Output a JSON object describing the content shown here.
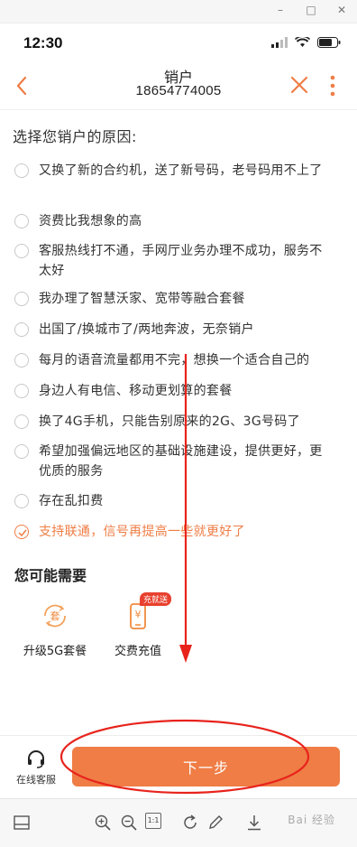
{
  "window": {
    "controls": [
      "–",
      "□",
      "✕"
    ]
  },
  "status_bar": {
    "time": "12:30"
  },
  "nav": {
    "title": "销户",
    "subtitle": "18654774005"
  },
  "content": {
    "section_title": "选择您销户的原因:",
    "reasons": [
      {
        "label": "又换了新的合约机，送了新号码，老号码用不上了",
        "checked": false
      },
      {
        "label": "资费比我想象的高",
        "checked": false
      },
      {
        "label": "客服热线打不通，手网厅业务办理不成功，服务不太好",
        "checked": false
      },
      {
        "label": "我办理了智慧沃家、宽带等融合套餐",
        "checked": false
      },
      {
        "label": "出国了/换城市了/两地奔波，无奈销户",
        "checked": false
      },
      {
        "label": "每月的语音流量都用不完，想换一个适合自己的",
        "checked": false
      },
      {
        "label": "身边人有电信、移动更划算的套餐",
        "checked": false
      },
      {
        "label": "换了4G手机，只能告别原来的2G、3G号码了",
        "checked": false
      },
      {
        "label": "希望加强偏远地区的基础设施建设，提供更好，更优质的服务",
        "checked": false
      },
      {
        "label": "存在乱扣费",
        "checked": false
      },
      {
        "label": "支持联通，信号再提高一些就更好了",
        "checked": true
      }
    ],
    "need_title": "您可能需要",
    "needs": [
      {
        "label": "升级5G套餐",
        "icon": "package-upgrade-icon",
        "icon_text": "套"
      },
      {
        "label": "交费充值",
        "icon": "recharge-phone-icon",
        "icon_text": "¥",
        "badge": "充就送"
      }
    ]
  },
  "bottom_bar": {
    "service_label": "在线客服",
    "next_label": "下一步"
  },
  "toolbar": {
    "fit_label": "1:1",
    "watermark": "Bai 经验"
  },
  "colors": {
    "accent": "#ef7d45",
    "annotation": "#e8231c"
  }
}
